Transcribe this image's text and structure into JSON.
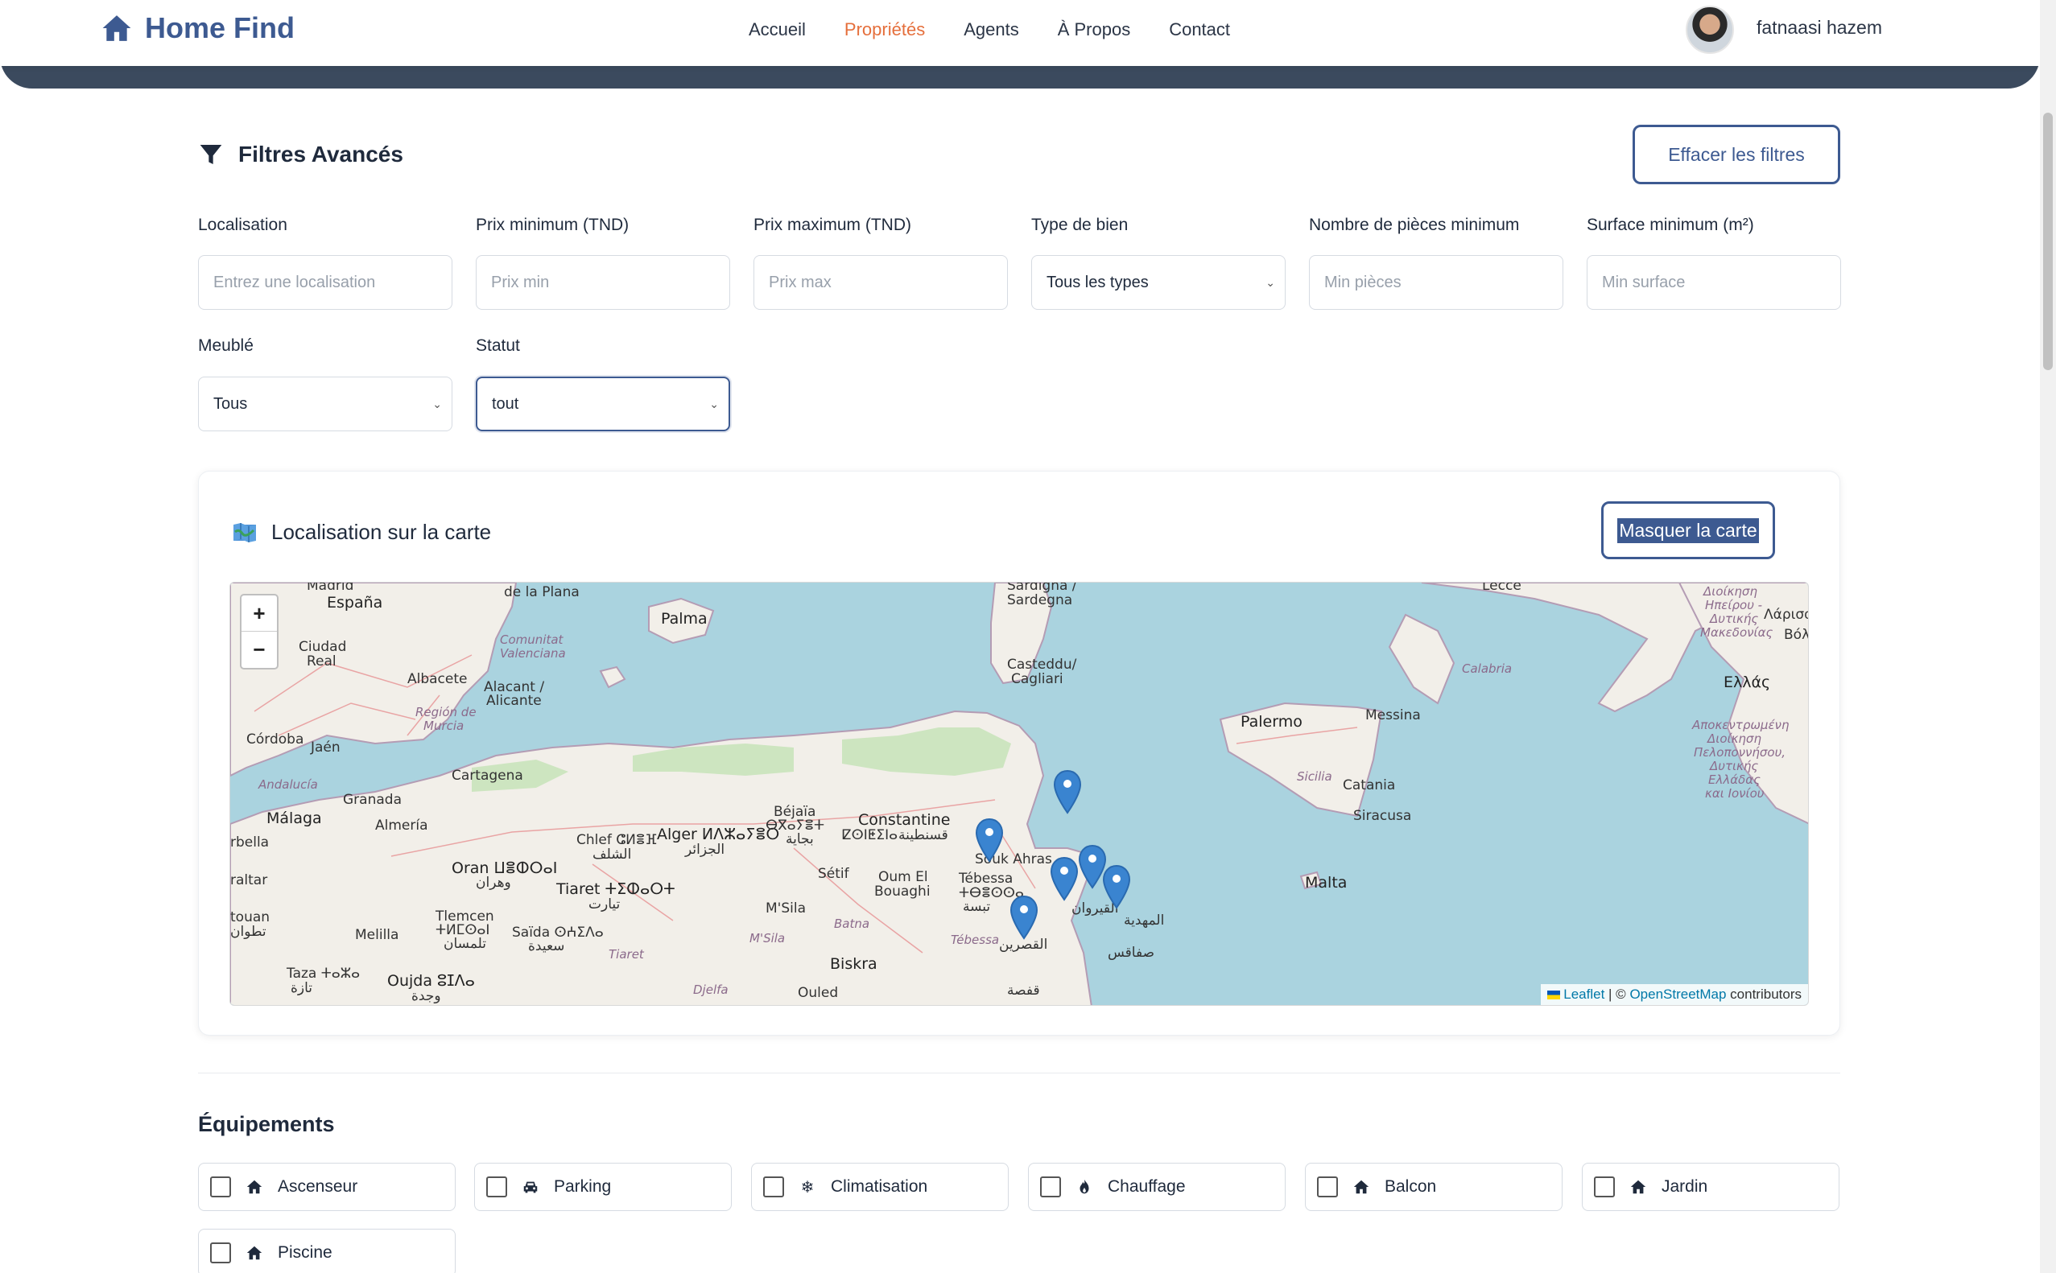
{
  "brand": {
    "name": "Home Find",
    "icon": "house-icon",
    "color": "#3d5a91"
  },
  "nav": {
    "links": [
      {
        "label": "Accueil",
        "active": false
      },
      {
        "label": "Propriétés",
        "active": true
      },
      {
        "label": "Agents",
        "active": false
      },
      {
        "label": "À Propos",
        "active": false
      },
      {
        "label": "Contact",
        "active": false
      }
    ],
    "active_color": "#e56f3c"
  },
  "user": {
    "name": "fatnaasi hazem",
    "avatar": "avatar"
  },
  "filters": {
    "title": "Filtres Avancés",
    "icon": "filter-icon",
    "clear_label": "Effacer les filtres",
    "fields": {
      "location": {
        "label": "Localisation",
        "placeholder": "Entrez une localisation",
        "value": ""
      },
      "price_min": {
        "label": "Prix minimum (TND)",
        "placeholder": "Prix min",
        "value": ""
      },
      "price_max": {
        "label": "Prix maximum (TND)",
        "placeholder": "Prix max",
        "value": ""
      },
      "type": {
        "label": "Type de bien",
        "value": "Tous les types"
      },
      "rooms_min": {
        "label": "Nombre de pièces minimum",
        "placeholder": "Min pièces",
        "value": ""
      },
      "surface_min": {
        "label": "Surface minimum (m²)",
        "placeholder": "Min surface",
        "value": ""
      },
      "furnished": {
        "label": "Meublé",
        "value": "Tous"
      },
      "status": {
        "label": "Statut",
        "value": "tout"
      }
    }
  },
  "map_section": {
    "title": "Localisation sur la carte",
    "icon": "map-icon",
    "hide_label": "Masquer la carte",
    "zoom_in": "+",
    "zoom_out": "−",
    "attribution": {
      "leaflet": "Leaflet",
      "sep": " | © ",
      "osm": "OpenStreetMap",
      "suffix": " contributors"
    },
    "marker_count": 6,
    "labels": {
      "madrid": "Madrid",
      "espana": "España",
      "plana": "de la Plana",
      "palma": "Palma",
      "sardigna": "Sardigna /",
      "sardegna": "Sardegna",
      "casteddu": "Casteddu/",
      "cagliari": "Cagliari",
      "lecce": "Lecce",
      "greek_top": "Διοίκηση",
      "greek_top2": "Ηπείρου -",
      "greek_top3": "Δυτικής",
      "greek_top4": "Μακεδονίας",
      "larisa": "Λάρισα",
      "volos": "Βόλο",
      "ellas": "Ελλάς",
      "greek_mid": "Αποκεντρωμένη",
      "greek_mid2": "Διοίκηση",
      "greek_mid3": "Πελοποννήσου,",
      "greek_mid4": "Δυτικής",
      "greek_mid5": "Ελλάδας",
      "greek_mid6": "και Ιονίου",
      "ciudad": "Ciudad",
      "real": "Real",
      "albacete": "Albacete",
      "comunitat": "Comunitat",
      "valenciana": "Valenciana",
      "alacant": "Alacant /",
      "alicante": "Alicante",
      "region_murcia": "Región de",
      "murcia": "Murcia",
      "cordoba": "Córdoba",
      "jaen": "Jaén",
      "cartagena": "Cartagena",
      "andalucia": "Andalucía",
      "granada": "Granada",
      "malaga": "Málaga",
      "almeria": "Almería",
      "marbella": "rbella",
      "gibraltar": "raltar",
      "tetouan": "touan",
      "tetouan_ar": "تطوان",
      "melilla": "Melilla",
      "taza": "Taza ⵜⴰⵣⴰ",
      "taza_ar": "تازة",
      "oujda": "Oujda ⵓⵊⴷⴰ",
      "oujda_ar": "وجدة",
      "tlemcen": "Tlemcen",
      "tlemcen_tif": "ⵜⵍⵎⵙⴰⵏ",
      "tlemcen_ar": "تلمسان",
      "oran": "Oran ⵡⴻⵀⵔⴰⵏ",
      "oran_ar": "وهران",
      "saida": "Saïda ⵙⵄⵉⴷⴰ",
      "saida_ar": "سعيدة",
      "chlef": "Chlef ⵛⵍⴻⴼ",
      "chlef_ar": "الشلف",
      "tiaret": "Tiaret ⵜⵉⵀⴰⵔⵜ",
      "tiaret_ar": "تيارت",
      "tiaret_region": "Tiaret",
      "alger": "Alger ⵍⴷⵣⴰⵢⴻⵔ",
      "alger_ar": "الجزائر",
      "bejaia": "Béjaïa",
      "bejaia_tif": "ⴱⴳⴰⵢⴻⵜ",
      "bejaia_ar": "بجاية",
      "constantine": "Constantine",
      "constantine_tif": "ⵇⵙⵏⵟⵉⵏⴰ",
      "constantine_ar": "قسنطينة",
      "setif": "Sétif",
      "oum": "Oum El",
      "bouaghi": "Bouaghi",
      "msila": "M'Sila",
      "msila_region": "M'Sila",
      "batna": "Batna",
      "djelfa": "Djelfa",
      "biskra": "Biskra",
      "ouled": "Ouled",
      "tebessa": "Tébessa",
      "tebessa_tif": "ⵜⴱⴻⵙⵙⴰ",
      "tebessa_ar": "تبسة",
      "tebessa_region": "Tébessa",
      "souk": "Souk Ahras",
      "kairouan_ar": "القيروان",
      "kasserine_ar": "القصرين",
      "gafsa_ar": "قفصة",
      "sfax_ar": "صفاقس",
      "mahdia_ar": "المهدية",
      "palermo": "Palermo",
      "messina": "Messina",
      "sicilia": "Sicilia",
      "catania": "Catania",
      "siracusa": "Siracusa",
      "calabria": "Calabria",
      "malta": "Malta"
    }
  },
  "equipments": {
    "title": "Équipements",
    "items": [
      {
        "label": "Ascenseur",
        "icon": "home-icon",
        "checked": false
      },
      {
        "label": "Parking",
        "icon": "car-icon",
        "checked": false
      },
      {
        "label": "Climatisation",
        "icon": "snowflake-icon",
        "checked": false
      },
      {
        "label": "Chauffage",
        "icon": "flame-icon",
        "checked": false
      },
      {
        "label": "Balcon",
        "icon": "home-icon",
        "checked": false
      },
      {
        "label": "Jardin",
        "icon": "home-icon",
        "checked": false
      },
      {
        "label": "Piscine",
        "icon": "home-icon",
        "checked": false
      }
    ]
  }
}
